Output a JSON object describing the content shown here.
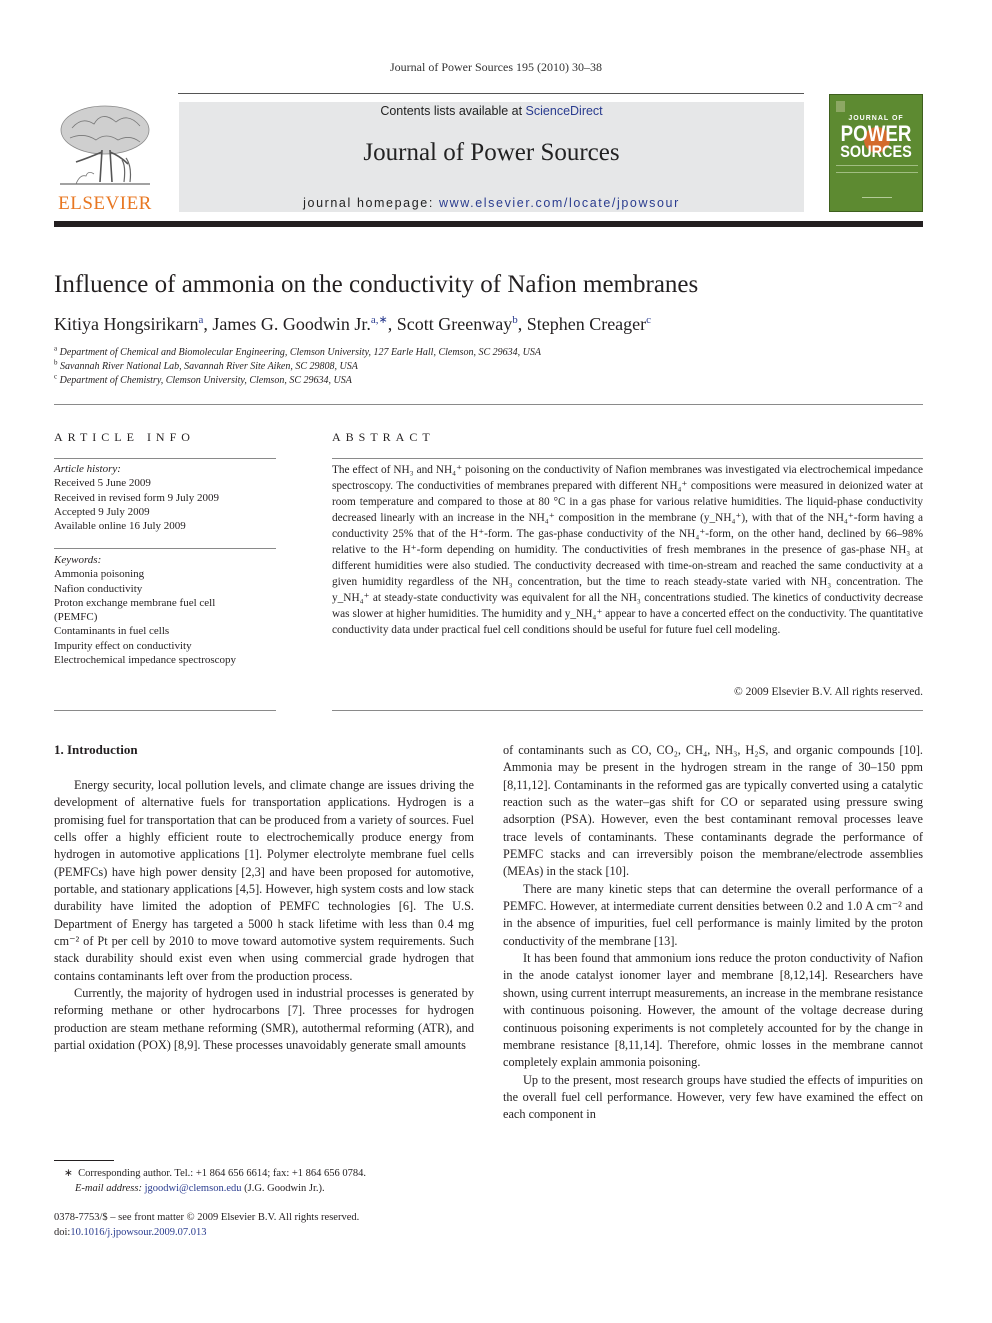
{
  "header": {
    "running_head": "Journal of Power Sources 195 (2010) 30–38",
    "publisher_logo_text": "ELSEVIER",
    "contents_prefix": "Contents lists available at ",
    "contents_link": "ScienceDirect",
    "journal_title": "Journal of Power Sources",
    "homepage_prefix": "journal homepage: ",
    "homepage_link": "www.elsevier.com/locate/jpowsour",
    "cover": {
      "line1": "JOURNAL OF",
      "line2": "POWER",
      "line3": "SOURCES",
      "accent_color": "#5d8a31"
    },
    "publisher_color": "#e87722",
    "link_color": "#2a3c8f"
  },
  "article": {
    "title": "Influence of ammonia on the conductivity of Nafion membranes",
    "authors": [
      {
        "name": "Kitiya Hongsirikarn",
        "sup": "a"
      },
      {
        "name": "James G. Goodwin Jr.",
        "sup": "a,∗"
      },
      {
        "name": "Scott Greenway",
        "sup": "b"
      },
      {
        "name": "Stephen Creager",
        "sup": "c"
      }
    ],
    "affiliations": [
      {
        "mark": "a",
        "text": "Department of Chemical and Biomolecular Engineering, Clemson University, 127 Earle Hall, Clemson, SC 29634, USA"
      },
      {
        "mark": "b",
        "text": "Savannah River National Lab, Savannah River Site Aiken, SC 29808, USA"
      },
      {
        "mark": "c",
        "text": "Department of Chemistry, Clemson University, Clemson, SC 29634, USA"
      }
    ]
  },
  "article_info": {
    "heading": "ARTICLE INFO",
    "history_label": "Article history:",
    "history": [
      "Received 5 June 2009",
      "Received in revised form 9 July 2009",
      "Accepted 9 July 2009",
      "Available online 16 July 2009"
    ],
    "keywords_label": "Keywords:",
    "keywords": [
      "Ammonia poisoning",
      "Nafion conductivity",
      "Proton exchange membrane fuel cell",
      "(PEMFC)",
      "Contaminants in fuel cells",
      "Impurity effect on conductivity",
      "Electrochemical impedance spectroscopy"
    ]
  },
  "abstract": {
    "heading": "ABSTRACT",
    "text": "The effect of NH₃ and NH₄⁺ poisoning on the conductivity of Nafion membranes was investigated via electrochemical impedance spectroscopy. The conductivities of membranes prepared with different NH₄⁺ compositions were measured in deionized water at room temperature and compared to those at 80 °C in a gas phase for various relative humidities. The liquid-phase conductivity decreased linearly with an increase in the NH₄⁺ composition in the membrane (y_NH₄⁺), with that of the NH₄⁺-form having a conductivity 25% that of the H⁺-form. The gas-phase conductivity of the NH₄⁺-form, on the other hand, declined by 66–98% relative to the H⁺-form depending on humidity. The conductivities of fresh membranes in the presence of gas-phase NH₃ at different humidities were also studied. The conductivity decreased with time-on-stream and reached the same conductivity at a given humidity regardless of the NH₃ concentration, but the time to reach steady-state varied with NH₃ concentration. The y_NH₄⁺ at steady-state conductivity was equivalent for all the NH₃ concentrations studied. The kinetics of conductivity decrease was slower at higher humidities. The humidity and y_NH₄⁺ appear to have a concerted effect on the conductivity. The quantitative conductivity data under practical fuel cell conditions should be useful for future fuel cell modeling.",
    "copyright": "© 2009 Elsevier B.V. All rights reserved."
  },
  "intro": {
    "heading": "1.  Introduction",
    "left_paragraphs": [
      "Energy security, local pollution levels, and climate change are issues driving the development of alternative fuels for transportation applications. Hydrogen is a promising fuel for transportation that can be produced from a variety of sources. Fuel cells offer a highly efficient route to electrochemically produce energy from hydrogen in automotive applications [1]. Polymer electrolyte membrane fuel cells (PEMFCs) have high power density [2,3] and have been proposed for automotive, portable, and stationary applications [4,5]. However, high system costs and low stack durability have limited the adoption of PEMFC technologies [6]. The U.S. Department of Energy has targeted a 5000 h stack lifetime with less than 0.4 mg cm⁻² of Pt per cell by 2010 to move toward automotive system requirements. Such stack durability should exist even when using commercial grade hydrogen that contains contaminants left over from the production process.",
      "Currently, the majority of hydrogen used in industrial processes is generated by reforming methane or other hydrocarbons [7]. Three processes for hydrogen production are steam methane reforming (SMR), autothermal reforming (ATR), and partial oxidation (POX) [8,9]. These processes unavoidably generate small amounts"
    ],
    "right_paragraphs": [
      "of contaminants such as CO, CO₂, CH₄, NH₃, H₂S, and organic compounds [10]. Ammonia may be present in the hydrogen stream in the range of 30–150 ppm [8,11,12]. Contaminants in the reformed gas are typically converted using a catalytic reaction such as the water–gas shift for CO or separated using pressure swing adsorption (PSA). However, even the best contaminant removal processes leave trace levels of contaminants. These contaminants degrade the performance of PEMFC stacks and can irreversibly poison the membrane/electrode assemblies (MEAs) in the stack [10].",
      "There are many kinetic steps that can determine the overall performance of a PEMFC. However, at intermediate current densities between 0.2 and 1.0 A cm⁻² and in the absence of impurities, fuel cell performance is mainly limited by the proton conductivity of the membrane [13].",
      "It has been found that ammonium ions reduce the proton conductivity of Nafion in the anode catalyst ionomer layer and membrane [8,12,14]. Researchers have shown, using current interrupt measurements, an increase in the membrane resistance with continuous poisoning. However, the amount of the voltage decrease during continuous poisoning experiments is not completely accounted for by the change in membrane resistance [8,11,14]. Therefore, ohmic losses in the membrane cannot completely explain ammonia poisoning.",
      "Up to the present, most research groups have studied the effects of impurities on the overall fuel cell performance. However, very few have examined the effect on each component in"
    ]
  },
  "footnotes": {
    "corresponding_mark": "∗",
    "corresponding_text": "Corresponding author. Tel.: +1 864 656 6614; fax: +1 864 656 0784.",
    "email_label": "E-mail address:",
    "email": "jgoodwi@clemson.edu",
    "email_suffix": "(J.G. Goodwin Jr.).",
    "front_matter": "0378-7753/$ – see front matter © 2009 Elsevier B.V. All rights reserved.",
    "doi_label": "doi:",
    "doi": "10.1016/j.jpowsour.2009.07.013"
  }
}
